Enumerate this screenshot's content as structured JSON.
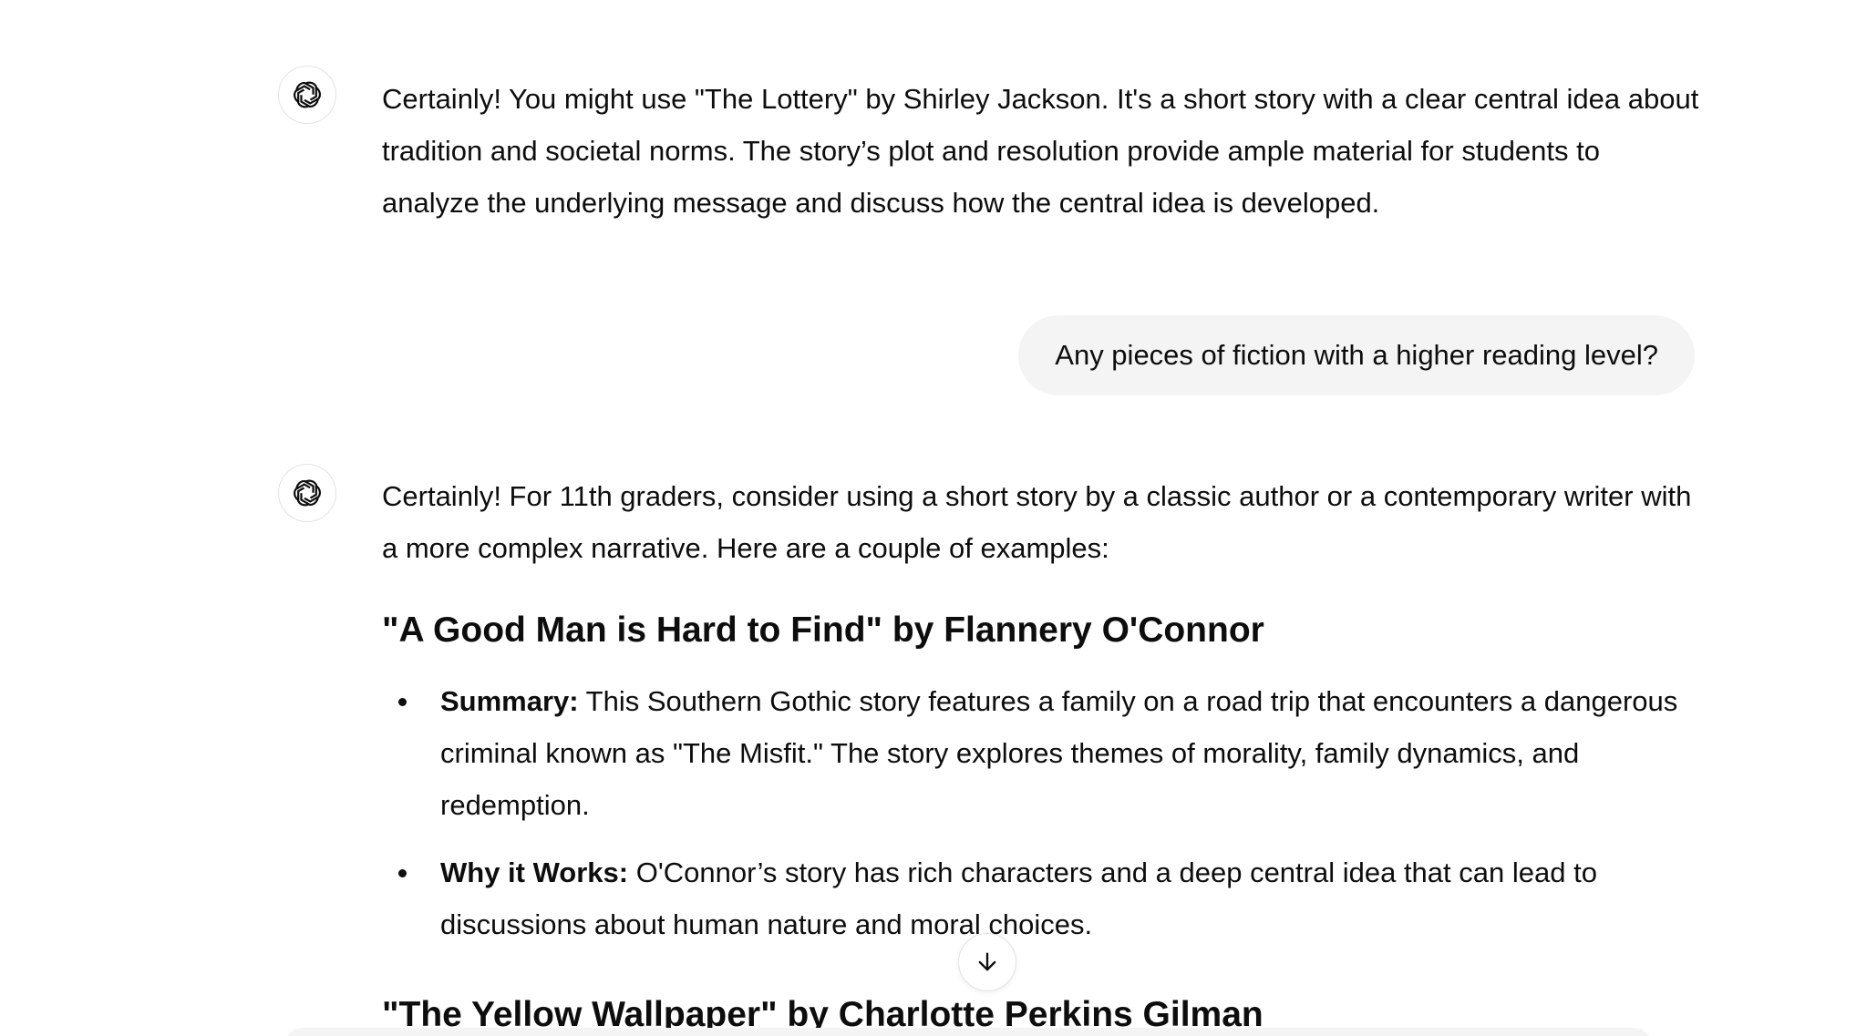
{
  "conversation": {
    "assistant_1": {
      "text": "Certainly! You might use \"The Lottery\" by Shirley Jackson. It's a short story with a clear central idea about tradition and societal norms. The story’s plot and resolution provide ample material for students to analyze the underlying message and discuss how the central idea is developed."
    },
    "user_1": {
      "text": "Any pieces of fiction with a higher reading level?"
    },
    "assistant_2": {
      "intro": "Certainly! For 11th graders, consider using a short story by a classic author or a contemporary writer with a more complex narrative. Here are a couple of examples:",
      "section_1": {
        "heading": "\"A Good Man is Hard to Find\" by Flannery O'Connor",
        "bullets": [
          {
            "label": "Summary:",
            "text": " This Southern Gothic story features a family on a road trip that encounters a dangerous criminal known as \"The Misfit.\" The story explores themes of morality, family dynamics, and redemption."
          },
          {
            "label": "Why it Works:",
            "text": " O'Connor’s story has rich characters and a deep central idea that can lead to discussions about human nature and moral choices."
          }
        ]
      },
      "section_2": {
        "heading": "\"The Yellow Wallpaper\" by Charlotte Perkins Gilman"
      }
    }
  },
  "icons": {
    "assistant_avatar": "openai-logo-icon",
    "scroll_down": "arrow-down-icon"
  },
  "colors": {
    "text": "#0d0d0d",
    "bubble": "#f4f4f4",
    "border": "#e3e3e3"
  }
}
